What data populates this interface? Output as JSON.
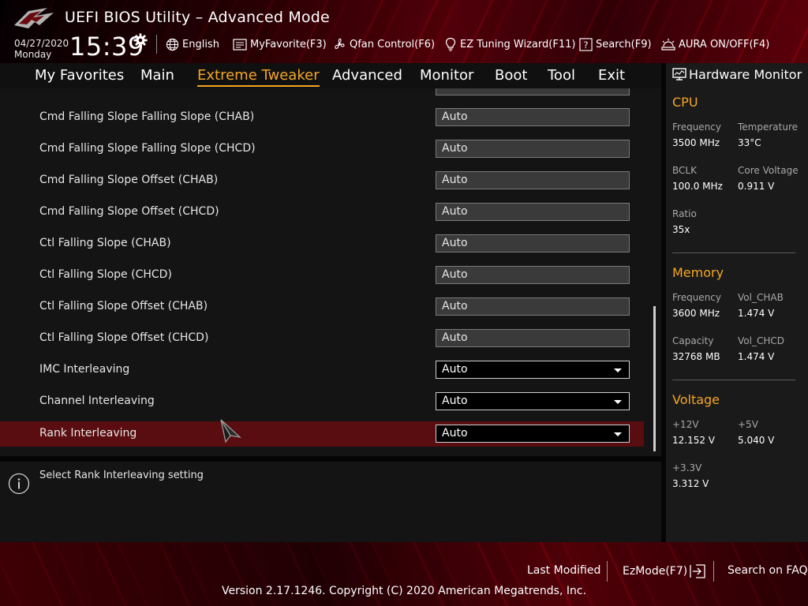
{
  "header": {
    "title": "UEFI BIOS Utility – Advanced Mode",
    "date": "04/27/2020",
    "day": "Monday",
    "time": "15:39",
    "toolbar": [
      {
        "label": "English",
        "icon": "globe-icon"
      },
      {
        "label": "MyFavorite(F3)",
        "icon": "favorite-list-icon"
      },
      {
        "label": "Qfan Control(F6)",
        "icon": "fan-icon"
      },
      {
        "label": "EZ Tuning Wizard(F11)",
        "icon": "lightbulb-icon"
      },
      {
        "label": "Search(F9)",
        "icon": "search-help-icon"
      },
      {
        "label": "AURA ON/OFF(F4)",
        "icon": "aura-icon"
      }
    ]
  },
  "nav": {
    "tabs": [
      "My Favorites",
      "Main",
      "Extreme Tweaker",
      "Advanced",
      "Monitor",
      "Boot",
      "Tool",
      "Exit"
    ],
    "active": "Extreme Tweaker"
  },
  "settings": [
    {
      "label": "Cmd Falling Slope Falling Slope (CHAB)",
      "value": "Auto",
      "type": "field"
    },
    {
      "label": "Cmd Falling Slope Falling Slope (CHCD)",
      "value": "Auto",
      "type": "field"
    },
    {
      "label": "Cmd Falling Slope Offset (CHAB)",
      "value": "Auto",
      "type": "field"
    },
    {
      "label": "Cmd Falling Slope Offset (CHCD)",
      "value": "Auto",
      "type": "field"
    },
    {
      "label": "Ctl Falling Slope (CHAB)",
      "value": "Auto",
      "type": "field"
    },
    {
      "label": "Ctl Falling Slope (CHCD)",
      "value": "Auto",
      "type": "field"
    },
    {
      "label": "Ctl Falling Slope Offset (CHAB)",
      "value": "Auto",
      "type": "field"
    },
    {
      "label": "Ctl Falling Slope Offset (CHCD)",
      "value": "Auto",
      "type": "field"
    },
    {
      "label": "IMC Interleaving",
      "value": "Auto",
      "type": "dropdown"
    },
    {
      "label": "Channel Interleaving",
      "value": "Auto",
      "type": "dropdown"
    },
    {
      "label": "Rank Interleaving",
      "value": "Auto",
      "type": "dropdown",
      "selected": true
    }
  ],
  "help": {
    "text": "Select Rank Interleaving setting"
  },
  "hardware_monitor": {
    "title": "Hardware Monitor",
    "cpu": {
      "heading": "CPU",
      "frequency_label": "Frequency",
      "frequency": "3500 MHz",
      "temperature_label": "Temperature",
      "temperature": "33°C",
      "bclk_label": "BCLK",
      "bclk": "100.0 MHz",
      "core_voltage_label": "Core Voltage",
      "core_voltage": "0.911 V",
      "ratio_label": "Ratio",
      "ratio": "35x"
    },
    "memory": {
      "heading": "Memory",
      "frequency_label": "Frequency",
      "frequency": "3600 MHz",
      "vol_chab_label": "Vol_CHAB",
      "vol_chab": "1.474 V",
      "capacity_label": "Capacity",
      "capacity": "32768 MB",
      "vol_chcd_label": "Vol_CHCD",
      "vol_chcd": "1.474 V"
    },
    "voltage": {
      "heading": "Voltage",
      "v12_label": "+12V",
      "v12": "12.152 V",
      "v5_label": "+5V",
      "v5": "5.040 V",
      "v33_label": "+3.3V",
      "v33": "3.312 V"
    }
  },
  "footer": {
    "last_modified": "Last Modified",
    "ezmode": "EzMode(F7)",
    "search_faq": "Search on FAQ",
    "version": "Version 2.17.1246. Copyright (C) 2020 American Megatrends, Inc."
  },
  "colors": {
    "accent": "#f5a623",
    "selected_row": "#5a0d10",
    "background": "#141414"
  }
}
